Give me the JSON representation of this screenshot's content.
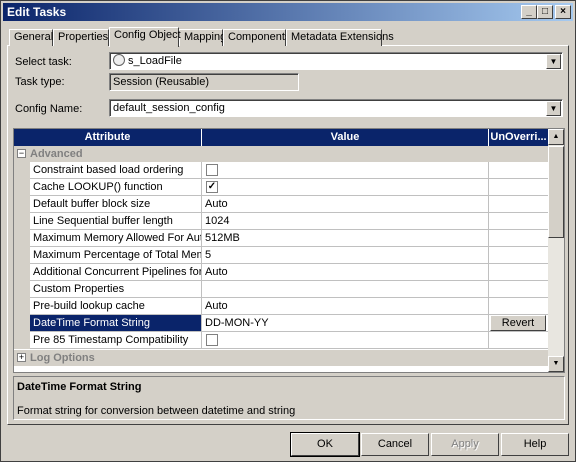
{
  "window": {
    "title": "Edit Tasks",
    "controls": [
      "_",
      "□",
      "×"
    ]
  },
  "tabs": [
    "General",
    "Properties",
    "Config Object",
    "Mapping",
    "Components",
    "Metadata Extensions"
  ],
  "active_tab": "Config Object",
  "form": {
    "select_task_label": "Select task:",
    "select_task_value": "s_LoadFile",
    "task_type_label": "Task type:",
    "task_type_value": "Session (Reusable)",
    "config_name_label": "Config Name:",
    "config_name_value": "default_session_config"
  },
  "grid": {
    "headers": [
      "Attribute",
      "Value",
      "UnOverri..."
    ],
    "category_advanced": "Advanced",
    "category_log": "Log Options",
    "rows": [
      {
        "attr": "Constraint based load ordering",
        "value": ""
      },
      {
        "attr": "Cache LOOKUP() function",
        "value": "✓"
      },
      {
        "attr": "Default buffer block size",
        "value": "Auto"
      },
      {
        "attr": "Line Sequential buffer length",
        "value": "1024"
      },
      {
        "attr": "Maximum Memory Allowed For Auto M...",
        "value": "512MB"
      },
      {
        "attr": "Maximum Percentage of Total Memory ...",
        "value": "5"
      },
      {
        "attr": "Additional Concurrent Pipelines for Loo...",
        "value": "Auto"
      },
      {
        "attr": "Custom Properties",
        "value": ""
      },
      {
        "attr": "Pre-build lookup cache",
        "value": "Auto"
      },
      {
        "attr": "DateTime Format String",
        "value": "DD-MON-YY",
        "action": "Revert"
      },
      {
        "attr": "Pre 85 Timestamp Compatibility",
        "value": ""
      }
    ]
  },
  "description": {
    "title": "DateTime Format String",
    "text": "Format string for conversion between datetime and string"
  },
  "buttons": {
    "ok": "OK",
    "cancel": "Cancel",
    "apply": "Apply",
    "help": "Help"
  }
}
